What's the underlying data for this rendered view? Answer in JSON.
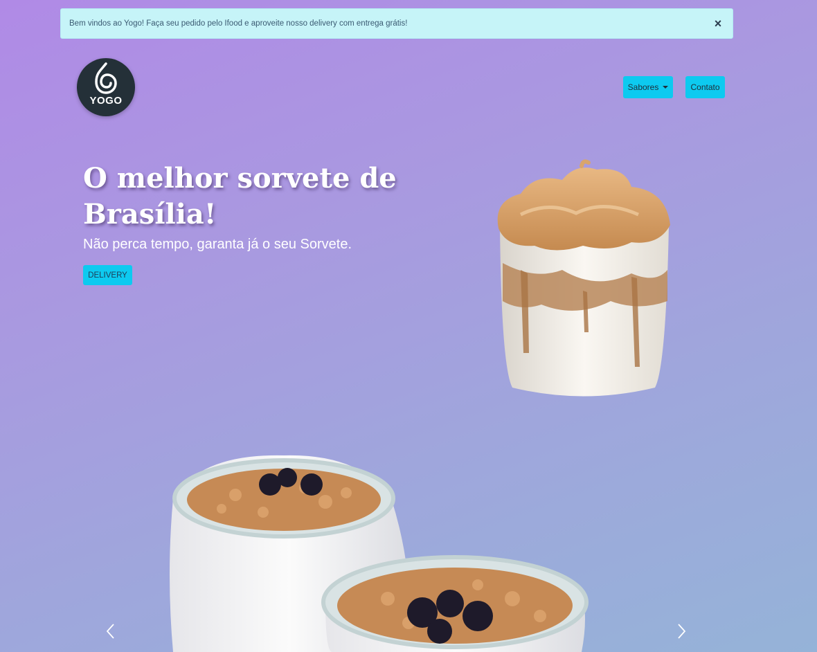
{
  "alert": {
    "message": "Bem vindos ao Yogo! Faça seu pedido pelo Ifood e aproveite nosso delivery com entrega grátis!",
    "close_label": "×"
  },
  "brand": {
    "logo_text": "YOGO",
    "logo_icon": "swirl-icon"
  },
  "nav": {
    "sabores_label": "Sabores",
    "contato_label": "Contato"
  },
  "hero": {
    "title": "O melhor sorvete de Brasília!",
    "subtitle": "Não perca tempo, garanta já o seu Sorvete.",
    "cta_label": "DELIVERY"
  },
  "carousel": {
    "prev_icon": "chevron-left-icon",
    "next_icon": "chevron-right-icon"
  },
  "colors": {
    "accent": "#0dcaf0",
    "alert_bg": "#c6f4f8",
    "logo_bg": "#243038"
  }
}
